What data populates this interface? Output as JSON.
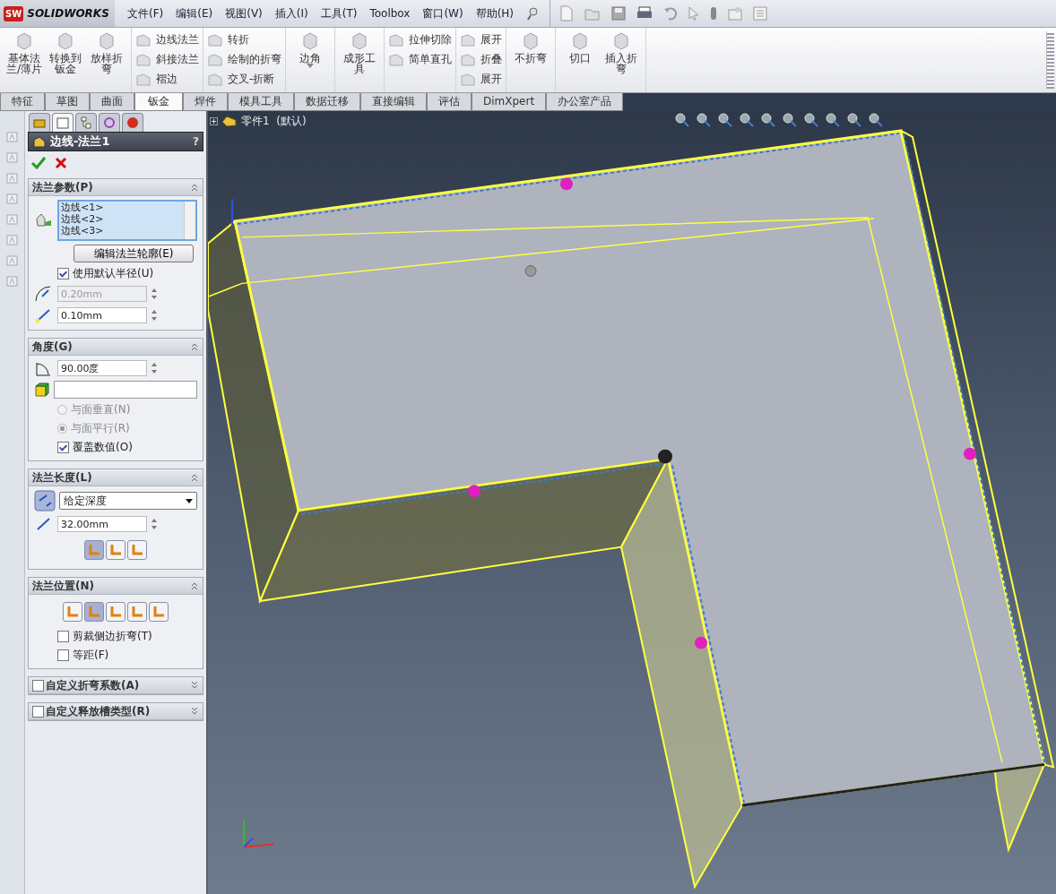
{
  "app": {
    "logo_badge": "SW",
    "logo": "SOLIDWORKS"
  },
  "menu": [
    "文件(F)",
    "编辑(E)",
    "视图(V)",
    "插入(I)",
    "工具(T)",
    "Toolbox",
    "窗口(W)",
    "帮助(H)"
  ],
  "ribbon": {
    "groups": [
      {
        "kind": "large",
        "items": [
          {
            "label": "基体法兰/薄片",
            "has_menu": false
          },
          {
            "label": "转换到钣金",
            "has_menu": false
          },
          {
            "label": "放样折弯",
            "has_menu": false
          }
        ]
      },
      {
        "kind": "small",
        "items": [
          {
            "label": "边线法兰"
          },
          {
            "label": "斜接法兰"
          },
          {
            "label": "褶边"
          }
        ]
      },
      {
        "kind": "small",
        "items": [
          {
            "label": "转折"
          },
          {
            "label": "绘制的折弯"
          },
          {
            "label": "交叉-折断"
          }
        ]
      },
      {
        "kind": "large",
        "items": [
          {
            "label": "边角",
            "has_menu": true
          }
        ]
      },
      {
        "kind": "large",
        "items": [
          {
            "label": "成形工具",
            "has_menu": false
          }
        ]
      },
      {
        "kind": "small",
        "items": [
          {
            "label": "拉伸切除"
          },
          {
            "label": "简单直孔"
          }
        ]
      },
      {
        "kind": "small",
        "items": [
          {
            "label": "展开"
          },
          {
            "label": "折叠"
          },
          {
            "label": "展开"
          }
        ]
      },
      {
        "kind": "large",
        "items": [
          {
            "label": "不折弯",
            "has_menu": false
          }
        ]
      },
      {
        "kind": "large",
        "items": [
          {
            "label": "切口",
            "has_menu": false
          },
          {
            "label": "插入折弯",
            "has_menu": false
          }
        ]
      }
    ]
  },
  "tabs": [
    {
      "label": "特征",
      "selected": false
    },
    {
      "label": "草图",
      "selected": false
    },
    {
      "label": "曲面",
      "selected": false
    },
    {
      "label": "钣金",
      "selected": true
    },
    {
      "label": "焊件",
      "selected": false
    },
    {
      "label": "模具工具",
      "selected": false
    },
    {
      "label": "数据迁移",
      "selected": false
    },
    {
      "label": "直接编辑",
      "selected": false
    },
    {
      "label": "评估",
      "selected": false
    },
    {
      "label": "DimXpert",
      "selected": false
    },
    {
      "label": "办公室产品",
      "selected": false
    }
  ],
  "property_manager": {
    "tabs": [
      {
        "selected": false
      },
      {
        "selected": true
      },
      {
        "selected": false
      },
      {
        "selected": false
      },
      {
        "selected": false
      }
    ],
    "title": "边线-法兰1",
    "help": "?",
    "sections": [
      {
        "title": "法兰参数(P)",
        "expanded": true,
        "rows": [
          {
            "kind": "edge-list",
            "items": [
              "边线<1>",
              "边线<2>",
              "边线<3>"
            ]
          },
          {
            "kind": "button",
            "label": "编辑法兰轮廓(E)"
          },
          {
            "kind": "checkbox",
            "label": "使用默认半径(U)",
            "checked": true
          },
          {
            "kind": "radius",
            "value": "0.20mm",
            "disabled": true
          },
          {
            "kind": "gap",
            "value": "0.10mm",
            "disabled": false
          }
        ]
      },
      {
        "title": "角度(G)",
        "expanded": true,
        "rows": [
          {
            "kind": "angle",
            "value": "90.00度",
            "disabled": false
          },
          {
            "kind": "face"
          },
          {
            "kind": "radio",
            "label": "与面垂直(N)",
            "selected": false,
            "disabled": true
          },
          {
            "kind": "radio",
            "label": "与面平行(R)",
            "selected": true,
            "disabled": true
          },
          {
            "kind": "checkbox",
            "label": "覆盖数值(O)",
            "checked": true
          }
        ]
      },
      {
        "title": "法兰长度(L)",
        "expanded": true,
        "rows": [
          {
            "kind": "dropdown",
            "value": "给定深度"
          },
          {
            "kind": "depth",
            "value": "32.00mm",
            "disabled": false
          },
          {
            "kind": "icon-buttons",
            "buttons": [
              {
                "selected": true
              },
              {
                "selected": false
              },
              {
                "selected": false
              }
            ]
          }
        ]
      },
      {
        "title": "法兰位置(N)",
        "expanded": true,
        "rows": [
          {
            "kind": "icon-buttons",
            "buttons": [
              {
                "selected": false
              },
              {
                "selected": true
              },
              {
                "selected": false
              },
              {
                "selected": false
              },
              {
                "selected": false
              }
            ]
          },
          {
            "kind": "checkbox",
            "label": "剪裁侧边折弯(T)",
            "checked": false
          },
          {
            "kind": "checkbox",
            "label": "等距(F)",
            "checked": false
          }
        ]
      },
      {
        "title": "自定义折弯系数(A)",
        "expanded": false,
        "checked": false
      },
      {
        "title": "自定义释放槽类型(R)",
        "expanded": false,
        "checked": false
      }
    ]
  },
  "viewport": {
    "tree_item": "零件1  (默认)"
  }
}
